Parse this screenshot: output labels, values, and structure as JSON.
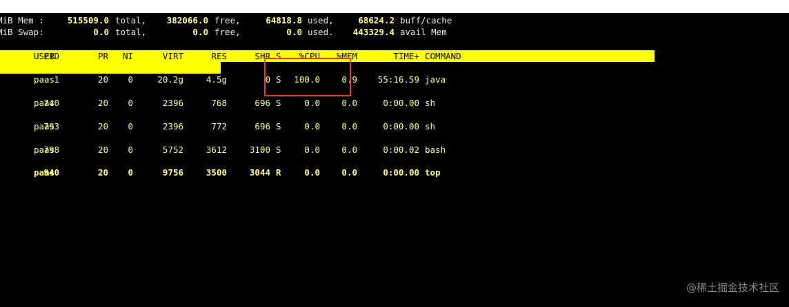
{
  "summary": {
    "mem": {
      "prefix": "MiB Mem :",
      "total": "515509.0",
      "total_label": "total,",
      "free": "382066.0",
      "free_label": "free,",
      "used": "64818.8",
      "used_label": "used,",
      "cache": "68624.2",
      "cache_label": "buff/cache"
    },
    "swap": {
      "prefix": "MiB Swap:",
      "total": "0.0",
      "total_label": "total,",
      "free": "0.0",
      "free_label": "free,",
      "used": "0.0",
      "used_label": "used.",
      "avail": "443329.4",
      "avail_label": "avail Mem"
    }
  },
  "table": {
    "headers": [
      "PID",
      "USER",
      "PR",
      "NI",
      "VIRT",
      "RES",
      "SHR",
      "S",
      "%CPU",
      "%MEM",
      "TIME+",
      "COMMAND"
    ],
    "rows": [
      [
        "1",
        "paas",
        "20",
        "0",
        "20.2g",
        "4.5g",
        "0",
        "S",
        "100.0",
        "0.9",
        "55:16.59",
        "java"
      ],
      [
        "740",
        "paas",
        "20",
        "0",
        "2396",
        "768",
        "696",
        "S",
        "0.0",
        "0.0",
        "0:00.00",
        "sh"
      ],
      [
        "793",
        "paas",
        "20",
        "0",
        "2396",
        "772",
        "696",
        "S",
        "0.0",
        "0.0",
        "0:00.00",
        "sh"
      ],
      [
        "798",
        "paas",
        "20",
        "0",
        "5752",
        "3612",
        "3100",
        "S",
        "0.0",
        "0.0",
        "0:00.02",
        "bash"
      ],
      [
        "940",
        "paas",
        "20",
        "0",
        "9756",
        "3500",
        "3044",
        "R",
        "0.0",
        "0.0",
        "0:00.00",
        "top"
      ]
    ]
  },
  "watermark": "@稀土掘金技术社区",
  "colors": {
    "background": "#000000",
    "text": "#ffff80",
    "header_bar": "#ffff00",
    "highlight_box": "#e53935"
  }
}
